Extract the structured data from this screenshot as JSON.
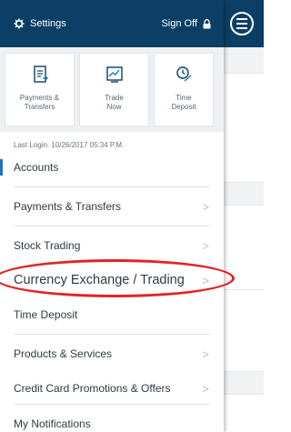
{
  "header": {
    "settings_label": "Settings",
    "signoff_label": "Sign Off"
  },
  "quick_actions": [
    {
      "label": "Payments &\nTransfers",
      "icon": "receipt-icon"
    },
    {
      "label": "Trade\nNow",
      "icon": "chart-icon"
    },
    {
      "label": "Time\nDeposit",
      "icon": "clock-icon"
    }
  ],
  "last_login": "Last Login: 10/26/2017 05:34 P.M.",
  "menu": [
    {
      "label": "Accounts"
    },
    {
      "label": "Payments & Transfers"
    },
    {
      "label": "Stock Trading"
    },
    {
      "label": "Currency Exchange / Trading"
    },
    {
      "label": "Time Deposit"
    },
    {
      "label": "Products & Services"
    },
    {
      "label": "Credit Card Promotions & Offers"
    },
    {
      "label": "My Notifications"
    }
  ],
  "colors": {
    "header_bg": "#0b3f66",
    "accent": "#1a73c9",
    "highlight_circle": "#e02424"
  }
}
